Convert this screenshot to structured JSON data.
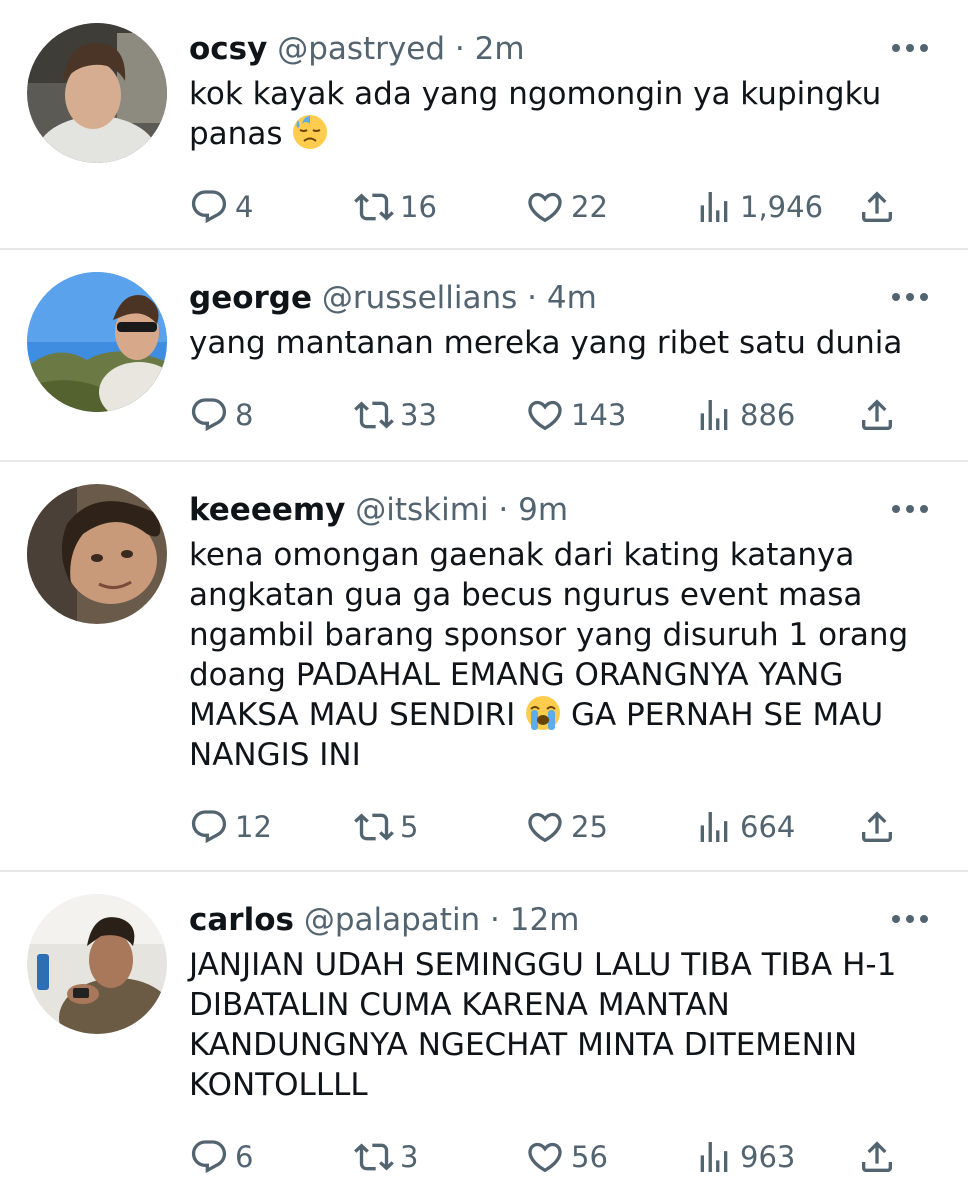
{
  "tweets": [
    {
      "name": "ocsy",
      "handle": "@pastryed",
      "time": "2m",
      "text": "kok kayak ada yang ngomongin ya kupingku\npanas",
      "emoji": "downcast-sweat-face",
      "replies": "4",
      "retweets": "16",
      "likes": "22",
      "views": "1,946"
    },
    {
      "name": "george",
      "handle": "@russellians",
      "time": "4m",
      "text": "yang mantanan mereka yang ribet satu dunia",
      "replies": "8",
      "retweets": "33",
      "likes": "143",
      "views": "886"
    },
    {
      "name": "keeeemy",
      "handle": "@itskimi",
      "time": "9m",
      "text_before": "kena omongan gaenak dari kating katanya\nangkatan gua ga becus ngurus event masa\nngambil barang sponsor yang disuruh 1 orang\ndoang PADAHAL EMANG ORANGNYA YANG\nMAKSA MAU SENDIRI ",
      "text_after": " GA PERNAH SE MAU\nNANGIS INI",
      "emoji": "loudly-crying-face",
      "replies": "12",
      "retweets": "5",
      "likes": "25",
      "views": "664"
    },
    {
      "name": "carlos",
      "handle": "@palapatin",
      "time": "12m",
      "text": "JANJIAN UDAH SEMINGGU LALU TIBA TIBA H-1\nDIBATALIN CUMA KARENA MANTAN\nKANDUNGNYA NGECHAT MINTA DITEMENIN\nKONTOLLLL",
      "replies": "6",
      "retweets": "3",
      "likes": "56",
      "views": "963"
    }
  ],
  "separator": " · ",
  "colors": {
    "text": "#0f1419",
    "secondary": "#536471",
    "divider": "#f0f2f4"
  }
}
